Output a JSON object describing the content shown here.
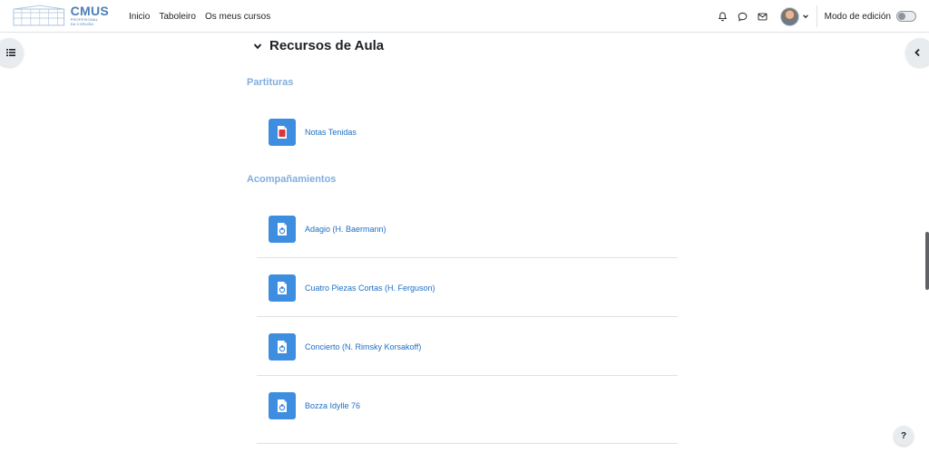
{
  "brand": {
    "main": "CMUS",
    "sub1": "PROFESIONAL",
    "sub2": "DA CORUÑA"
  },
  "nav": {
    "links": [
      "Inicio",
      "Taboleiro",
      "Os meus cursos"
    ]
  },
  "user_menu": {
    "edit_mode_label": "Modo de edición",
    "edit_mode_on": false
  },
  "section": {
    "title": "Recursos de Aula",
    "groups": [
      {
        "heading": "Partituras",
        "items": [
          {
            "label": "Notas Tenidas",
            "icon": "pdf-file-icon"
          }
        ]
      },
      {
        "heading": "Acompañamientos",
        "items": [
          {
            "label": "Adagio (H. Baermann)",
            "icon": "audio-file-icon"
          },
          {
            "label": "Cuatro Piezas Cortas (H. Ferguson)",
            "icon": "audio-file-icon"
          },
          {
            "label": "Concierto (N. Rimsky Korsakoff)",
            "icon": "audio-file-icon"
          },
          {
            "label": "Bozza Idylle 76",
            "icon": "audio-file-icon"
          }
        ]
      }
    ]
  },
  "help": {
    "label": "?"
  },
  "colors": {
    "link": "#1d6fc4",
    "subheading": "#7faee0",
    "activity_icon_bg": "#3d8ee0",
    "brand": "#4a7fb5"
  }
}
